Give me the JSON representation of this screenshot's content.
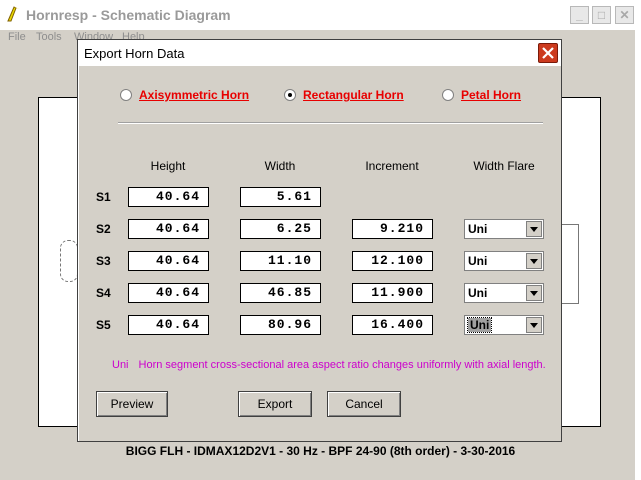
{
  "app": {
    "title": "Hornresp - Schematic Diagram",
    "window_controls": {
      "minimize": "_",
      "maximize": "□",
      "close": "✕"
    },
    "menu": [
      "File",
      "Tools",
      "Window",
      "Help"
    ]
  },
  "status_caption": "BIGG FLH - IDMAX12D2V1 - 30 Hz - BPF 24-90 (8th order) - 3-30-2016",
  "dialog": {
    "title": "Export Horn Data",
    "horn_types": [
      {
        "label": "Axisymmetric Horn",
        "selected": false
      },
      {
        "label": "Rectangular Horn",
        "selected": true
      },
      {
        "label": "Petal Horn",
        "selected": false
      }
    ],
    "columns": {
      "height": "Height",
      "width": "Width",
      "increment": "Increment",
      "width_flare": "Width Flare"
    },
    "rows": [
      {
        "label": "S1",
        "height": "40.64",
        "width": "5.61",
        "increment": "",
        "flare": ""
      },
      {
        "label": "S2",
        "height": "40.64",
        "width": "6.25",
        "increment": "9.210",
        "flare": "Uni"
      },
      {
        "label": "S3",
        "height": "40.64",
        "width": "11.10",
        "increment": "12.100",
        "flare": "Uni"
      },
      {
        "label": "S4",
        "height": "40.64",
        "width": "46.85",
        "increment": "11.900",
        "flare": "Uni"
      },
      {
        "label": "S5",
        "height": "40.64",
        "width": "80.96",
        "increment": "16.400",
        "flare": "Uni"
      }
    ],
    "note_abbr": "Uni",
    "note_text": "Horn segment cross-sectional area aspect ratio changes uniformly with axial length.",
    "buttons": {
      "preview": "Preview",
      "export": "Export",
      "cancel": "Cancel"
    },
    "colors": {
      "radio_label": "#e80000",
      "note": "#cc00cc",
      "close_button": "#cc3a1e"
    }
  }
}
